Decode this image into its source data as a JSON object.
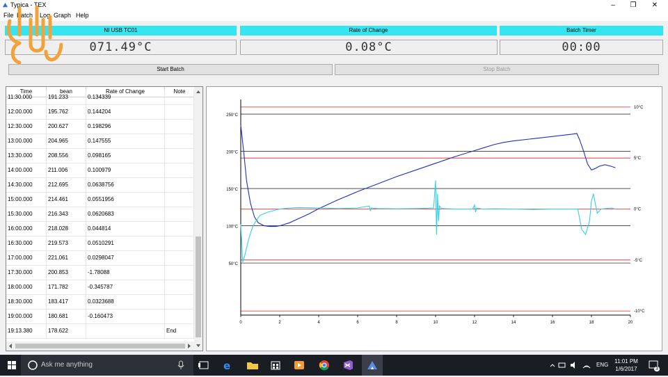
{
  "window": {
    "title": "Typica - TEX",
    "minimize": "–",
    "maximize": "❐",
    "close": "✕"
  },
  "menu": [
    {
      "label": "File"
    },
    {
      "label": "Batch"
    },
    {
      "label": "Log"
    },
    {
      "label": "Graph"
    },
    {
      "label": "Help"
    }
  ],
  "colors": {
    "accent": "#34e6f0",
    "logo": "#f2a23a",
    "grid_red": "#e02020",
    "bean_series": "#1f2fbf",
    "ror_series": "#2fd0e8"
  },
  "indicators": [
    {
      "label": "NI USB TC01",
      "value": "071.49°C"
    },
    {
      "label": "Rate of Change",
      "value": "0.08°C"
    },
    {
      "label": "Batch Timer",
      "value": "00:00"
    }
  ],
  "buttons": {
    "start": "Start Batch",
    "stop": "Stop Batch"
  },
  "table": {
    "columns": [
      "Time",
      "bean",
      "Rate of Change",
      "Note"
    ],
    "rows": [
      [
        "11:30.000",
        "191.233",
        "0.134339",
        ""
      ],
      [
        "12:00.000",
        "195.762",
        "0.144204",
        ""
      ],
      [
        "12:30.000",
        "200.627",
        "0.198296",
        ""
      ],
      [
        "13:00.000",
        "204.965",
        "0.147555",
        ""
      ],
      [
        "13:30.000",
        "208.556",
        "0.098165",
        ""
      ],
      [
        "14:00.000",
        "211.006",
        "0.100979",
        ""
      ],
      [
        "14:30.000",
        "212.695",
        "0.0638756",
        ""
      ],
      [
        "15:00.000",
        "214.461",
        "0.0551956",
        ""
      ],
      [
        "15:30.000",
        "216.343",
        "0.0620683",
        ""
      ],
      [
        "16:00.000",
        "218.028",
        "0.044814",
        ""
      ],
      [
        "16:30.000",
        "219.573",
        "0.0510291",
        ""
      ],
      [
        "17:00.000",
        "221.061",
        "0.0298047",
        ""
      ],
      [
        "17:30.000",
        "200.853",
        "-1.78088",
        ""
      ],
      [
        "18:00.000",
        "171.782",
        "-0.345787",
        ""
      ],
      [
        "18:30.000",
        "183.417",
        "0.0323688",
        ""
      ],
      [
        "19:00.000",
        "180.681",
        "-0.160473",
        ""
      ],
      [
        "19:13.380",
        "178.622",
        "",
        "End"
      ]
    ]
  },
  "chart_data": {
    "type": "line",
    "xlim": [
      0,
      20
    ],
    "x_ticks": [
      "0",
      "2",
      "4",
      "6",
      "8",
      "10",
      "12",
      "14",
      "16",
      "18",
      "20"
    ],
    "left_axis": {
      "ticks": [
        "250°C",
        "200°C",
        "150°C",
        "100°C",
        "50°C"
      ],
      "values": [
        250,
        200,
        150,
        100,
        50
      ],
      "ylim": [
        -20,
        265
      ]
    },
    "right_axis": {
      "ticks": [
        "10°C",
        "5°C",
        "0°C",
        "-5°C",
        "-10°C"
      ],
      "values": [
        10,
        5,
        0,
        -5,
        -10
      ],
      "ylim": [
        -10.4,
        10.4
      ]
    },
    "grid": true,
    "series": [
      {
        "axis": "left",
        "points": [
          [
            0,
            235
          ],
          [
            0.15,
            200
          ],
          [
            0.3,
            160
          ],
          [
            0.5,
            130
          ],
          [
            0.7,
            112
          ],
          [
            0.9,
            104
          ],
          [
            1.2,
            100
          ],
          [
            1.5,
            99
          ],
          [
            1.8,
            99
          ],
          [
            2,
            100
          ],
          [
            2.5,
            104
          ],
          [
            3,
            110
          ],
          [
            3.5,
            116
          ],
          [
            4,
            123
          ],
          [
            5,
            135
          ],
          [
            6,
            146
          ],
          [
            7,
            156
          ],
          [
            8,
            166
          ],
          [
            9,
            175
          ],
          [
            10,
            184
          ],
          [
            11,
            193
          ],
          [
            12,
            201
          ],
          [
            12.5,
            205
          ],
          [
            13,
            209
          ],
          [
            13.5,
            212
          ],
          [
            14,
            214
          ],
          [
            15,
            217
          ],
          [
            16,
            220
          ],
          [
            17,
            223
          ],
          [
            17.25,
            224
          ],
          [
            17.4,
            215
          ],
          [
            17.6,
            200
          ],
          [
            17.8,
            183
          ],
          [
            18,
            175
          ],
          [
            18.2,
            177
          ],
          [
            18.4,
            180
          ],
          [
            18.7,
            182
          ],
          [
            19,
            180
          ],
          [
            19.23,
            178
          ]
        ]
      },
      {
        "axis": "right",
        "points": [
          [
            0,
            -1.5
          ],
          [
            0.1,
            -5.2
          ],
          [
            0.2,
            -4.6
          ],
          [
            0.4,
            -3
          ],
          [
            0.6,
            -1.8
          ],
          [
            0.8,
            -1.1
          ],
          [
            1,
            -0.6
          ],
          [
            1.4,
            -0.3
          ],
          [
            2,
            0
          ],
          [
            2.5,
            0.1
          ],
          [
            3,
            0.15
          ],
          [
            4,
            0.1
          ],
          [
            5,
            0.05
          ],
          [
            6,
            0.1
          ],
          [
            6.6,
            0.3
          ],
          [
            6.65,
            -0.2
          ],
          [
            6.7,
            0.1
          ],
          [
            7,
            0.05
          ],
          [
            8,
            0.02
          ],
          [
            9,
            0.05
          ],
          [
            9.9,
            0.1
          ],
          [
            10,
            2.8
          ],
          [
            10.05,
            -2.5
          ],
          [
            10.1,
            1.5
          ],
          [
            10.15,
            -1.2
          ],
          [
            10.2,
            0.3
          ],
          [
            10.3,
            0.05
          ],
          [
            11,
            0
          ],
          [
            11.9,
            0
          ],
          [
            12,
            0.4
          ],
          [
            12.05,
            -0.3
          ],
          [
            12.1,
            0.1
          ],
          [
            12.4,
            0
          ],
          [
            13,
            0.02
          ],
          [
            14,
            0
          ],
          [
            15,
            -0.05
          ],
          [
            16,
            0
          ],
          [
            17,
            0
          ],
          [
            17.3,
            0
          ],
          [
            17.5,
            -2
          ],
          [
            17.7,
            -2.5
          ],
          [
            17.9,
            -1.2
          ],
          [
            18,
            0.8
          ],
          [
            18.1,
            1.5
          ],
          [
            18.2,
            0.5
          ],
          [
            18.3,
            -0.4
          ],
          [
            18.5,
            0
          ],
          [
            19,
            0.1
          ],
          [
            19.23,
            0
          ]
        ]
      }
    ]
  },
  "taskbar": {
    "search_placeholder": "Ask me anything",
    "time": "11:01 PM",
    "date": "1/6/2017",
    "language": "ENG",
    "notifications": "3"
  }
}
